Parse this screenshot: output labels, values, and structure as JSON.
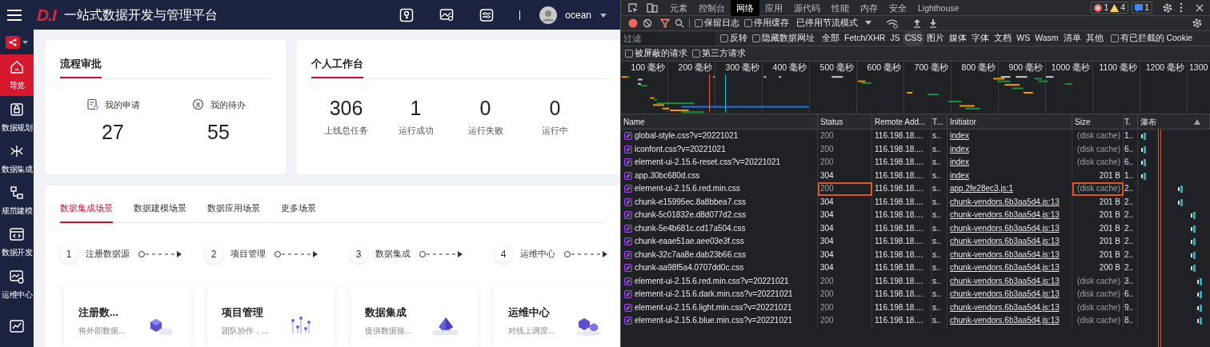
{
  "app": {
    "header": {
      "logo": "D.I",
      "title": "一站式数据开发与管理平台",
      "user": "ocean"
    },
    "sidebar": [
      {
        "label": "导览",
        "selected": true
      },
      {
        "label": "数据规划",
        "selected": false
      },
      {
        "label": "数据集成",
        "selected": false
      },
      {
        "label": "规范建模",
        "selected": false
      },
      {
        "label": "数据开发",
        "selected": false
      },
      {
        "label": "运维中心",
        "selected": false
      }
    ],
    "approval": {
      "title": "流程审批",
      "items": [
        {
          "label": "我的申请",
          "value": "27"
        },
        {
          "label": "我的待办",
          "value": "55"
        }
      ]
    },
    "workbench": {
      "title": "个人工作台",
      "stats": [
        {
          "value": "306",
          "label": "上线总任务"
        },
        {
          "value": "1",
          "label": "运行成功"
        },
        {
          "value": "0",
          "label": "运行失败"
        },
        {
          "value": "0",
          "label": "运行中"
        }
      ]
    },
    "scenarios": {
      "tabs": [
        {
          "label": "数据集成场景",
          "selected": true
        },
        {
          "label": "数据建模场景",
          "selected": false
        },
        {
          "label": "数据应用场景",
          "selected": false
        },
        {
          "label": "更多场景",
          "selected": false
        }
      ],
      "steps": [
        {
          "number": "1",
          "label": "注册数据源"
        },
        {
          "number": "2",
          "label": "项目管理"
        },
        {
          "number": "3",
          "label": "数据集成"
        },
        {
          "number": "4",
          "label": "运维中心"
        }
      ],
      "cards": [
        {
          "title": "注册数...",
          "desc": "将外部数据..."
        },
        {
          "title": "项目管理",
          "desc": "团队协作，..."
        },
        {
          "title": "数据集成",
          "desc": "提供数据接..."
        },
        {
          "title": "运维中心",
          "desc": "对线上调度..."
        }
      ]
    }
  },
  "devtools": {
    "tabs": [
      {
        "label": "元素",
        "selected": false
      },
      {
        "label": "控制台",
        "selected": false
      },
      {
        "label": "网络",
        "selected": true
      },
      {
        "label": "应用",
        "selected": false
      },
      {
        "label": "源代码",
        "selected": false
      },
      {
        "label": "性能",
        "selected": false
      },
      {
        "label": "内存",
        "selected": false
      },
      {
        "label": "安全",
        "selected": false
      },
      {
        "label": "Lighthouse",
        "selected": false
      }
    ],
    "issues": {
      "errors": "1",
      "warnings": "4",
      "messages": "1"
    },
    "toolbar": {
      "recording": true,
      "filter_active": true,
      "checkboxes": [
        {
          "label": "保留日志",
          "checked": false
        },
        {
          "label": "停用缓存",
          "checked": false
        }
      ],
      "throttle": "已停用节流模式"
    },
    "filter": {
      "placeholder": "过滤",
      "checkboxes": [
        {
          "label": "反转",
          "checked": false
        },
        {
          "label": "隐藏数据网址",
          "checked": false
        }
      ],
      "types": [
        {
          "label": "全部",
          "selected": false
        },
        {
          "label": "Fetch/XHR",
          "selected": false
        },
        {
          "label": "JS",
          "selected": false
        },
        {
          "label": "CSS",
          "selected": true
        },
        {
          "label": "图片",
          "selected": false
        },
        {
          "label": "媒体",
          "selected": false
        },
        {
          "label": "字体",
          "selected": false
        },
        {
          "label": "文档",
          "selected": false
        },
        {
          "label": "WS",
          "selected": false
        },
        {
          "label": "Wasm",
          "selected": false
        },
        {
          "label": "清单",
          "selected": false
        },
        {
          "label": "其他",
          "selected": false
        }
      ],
      "cookie_checkbox": {
        "label": "有已拦截的 Cookie",
        "checked": false
      },
      "row2": [
        {
          "label": "被屏蔽的请求",
          "checked": false
        },
        {
          "label": "第三方请求",
          "checked": false
        }
      ]
    },
    "overview_ticks": [
      "100 毫秒",
      "200 毫秒",
      "300 毫秒",
      "400 毫秒",
      "500 毫秒",
      "600 毫秒",
      "700 毫秒",
      "800 毫秒",
      "900 毫秒",
      "1000 毫秒",
      "1100 毫秒",
      "1200 毫秒",
      "1300"
    ],
    "table": {
      "columns": [
        "Name",
        "Status",
        "Remote Add...",
        "T...",
        "Initiator",
        "Size",
        "T.",
        "瀑布"
      ],
      "rows": [
        {
          "name": "global-style.css?v=20221021",
          "status": "200",
          "remote": "116.198.18....",
          "column_4": "s..",
          "initiator": "index",
          "size": "(disk cache)",
          "column_7": "1..",
          "cached": true,
          "highlighted": false
        },
        {
          "name": "iconfont.css?v=20221021",
          "status": "200",
          "remote": "116.198.18....",
          "column_4": "s..",
          "initiator": "index",
          "size": "(disk cache)",
          "column_7": "6..",
          "cached": true,
          "highlighted": false
        },
        {
          "name": "element-ui-2.15.6-reset.css?v=20221021",
          "status": "200",
          "remote": "116.198.18....",
          "column_4": "s..",
          "initiator": "index",
          "size": "(disk cache)",
          "column_7": "6..",
          "cached": true,
          "highlighted": false
        },
        {
          "name": "app.30bc680d.css",
          "status": "304",
          "remote": "116.198.18....",
          "column_4": "s..",
          "initiator": "index",
          "size": "201 B",
          "column_7": "1..",
          "cached": false,
          "highlighted": false
        },
        {
          "name": "element-ui-2.15.6.red.min.css",
          "status": "200",
          "remote": "116.198.18....",
          "column_4": "s..",
          "initiator": "app.2fe28ec3.js:1",
          "size": "(disk cache)",
          "column_7": "2..",
          "cached": true,
          "highlighted": true
        },
        {
          "name": "chunk-e15995ec.8a8bbea7.css",
          "status": "304",
          "remote": "116.198.18....",
          "column_4": "s..",
          "initiator": "chunk-vendors.6b3aa5d4.js:13",
          "size": "201 B",
          "column_7": "2..",
          "cached": false,
          "highlighted": false
        },
        {
          "name": "chunk-5c01832e.d8d077d2.css",
          "status": "304",
          "remote": "116.198.18....",
          "column_4": "s..",
          "initiator": "chunk-vendors.6b3aa5d4.js:13",
          "size": "201 B",
          "column_7": "2..",
          "cached": false,
          "highlighted": false
        },
        {
          "name": "chunk-5e4b681c.cd17a504.css",
          "status": "304",
          "remote": "116.198.18....",
          "column_4": "s..",
          "initiator": "chunk-vendors.6b3aa5d4.js:13",
          "size": "201 B",
          "column_7": "2..",
          "cached": false,
          "highlighted": false
        },
        {
          "name": "chunk-eaae51ae.aee03e3f.css",
          "status": "304",
          "remote": "116.198.18....",
          "column_4": "s..",
          "initiator": "chunk-vendors.6b3aa5d4.js:13",
          "size": "201 B",
          "column_7": "2..",
          "cached": false,
          "highlighted": false
        },
        {
          "name": "chunk-32c7aa8e.dab23b66.css",
          "status": "304",
          "remote": "116.198.18....",
          "column_4": "s..",
          "initiator": "chunk-vendors.6b3aa5d4.js:13",
          "size": "201 B",
          "column_7": "2..",
          "cached": false,
          "highlighted": false
        },
        {
          "name": "chunk-aa98f5a4.0707dd0c.css",
          "status": "304",
          "remote": "116.198.18....",
          "column_4": "s..",
          "initiator": "chunk-vendors.6b3aa5d4.js:13",
          "size": "200 B",
          "column_7": "2..",
          "cached": false,
          "highlighted": false
        },
        {
          "name": "element-ui-2.15.6.red.min.css?v=20221021",
          "status": "200",
          "remote": "116.198.18....",
          "column_4": "s..",
          "initiator": "chunk-vendors.6b3aa5d4.js:13",
          "size": "(disk cache)",
          "column_7": "3..",
          "cached": true,
          "highlighted": false
        },
        {
          "name": "element-ui-2.15.6.dark.min.css?v=20221021",
          "status": "200",
          "remote": "116.198.18....",
          "column_4": "s..",
          "initiator": "chunk-vendors.6b3aa5d4.js:13",
          "size": "(disk cache)",
          "column_7": "6..",
          "cached": true,
          "highlighted": false
        },
        {
          "name": "element-ui-2.15.6.light.min.css?v=20221021",
          "status": "200",
          "remote": "116.198.18....",
          "column_4": "s..",
          "initiator": "chunk-vendors.6b3aa5d4.js:13",
          "size": "(disk cache)",
          "column_7": "9..",
          "cached": true,
          "highlighted": false
        },
        {
          "name": "element-ui-2.15.6.blue.min.css?v=20221021",
          "status": "200",
          "remote": "116.198.18....",
          "column_4": "s..",
          "initiator": "chunk-vendors.6b3aa5d4.js:13",
          "size": "(disk cache)",
          "column_7": "8..",
          "cached": true,
          "highlighted": false
        }
      ]
    }
  }
}
